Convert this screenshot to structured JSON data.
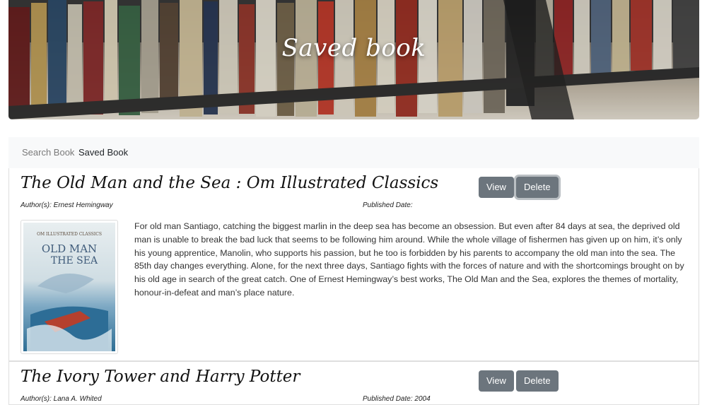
{
  "hero": {
    "title": "Saved book"
  },
  "nav": {
    "search_label": "Search Book",
    "saved_label": "Saved Book"
  },
  "books": [
    {
      "title": "The Old Man and the Sea : Om Illustrated Classics",
      "authors": "Author(s): Ernest Hemingway",
      "published": "Published Date:",
      "view_label": "View",
      "delete_label": "Delete",
      "description": "For old man Santiago, catching the biggest marlin in the deep sea has become an obsession. But even after 84 days at sea, the deprived old man is unable to break the bad luck that seems to be following him around. While the whole village of fishermen has given up on him, it’s only his young apprentice, Manolin, who supports his passion, but he too is forbidden by his parents to accompany the old man into the sea. The 85th day changes everything. Alone, for the next three days, Santiago fights with the forces of nature and with the shortcomings brought on by his old age in search of the great catch. One of Ernest Hemingway’s best works, The Old Man and the Sea, explores the themes of mortality, honour-in-defeat and man’s place nature.",
      "cover": {
        "series": "OM ILLUSTRATED CLASSICS",
        "line1": "OLD MAN",
        "line2": "THE SEA"
      }
    },
    {
      "title": "The Ivory Tower and Harry Potter",
      "authors": "Author(s): Lana A. Whited",
      "published": "Published Date: 2004",
      "view_label": "View",
      "delete_label": "Delete"
    }
  ],
  "colors": {
    "button": "#6c757d",
    "navbar": "#f8f9fa"
  }
}
